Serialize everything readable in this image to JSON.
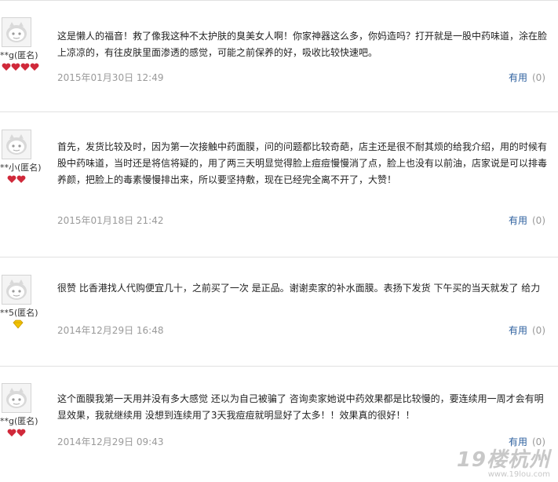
{
  "reviews": [
    {
      "user": "**g(匿名)",
      "rank_icon": "heart-icon",
      "rank_count": 4,
      "text": "这是懒人的福音！救了像我这种不太护肤的臭美女人啊！你家神器这么多，你妈造吗？打开就是一股中药味道，涂在脸上凉凉的，有往皮肤里面渗透的感觉，可能之前保养的好，吸收比较快速吧。",
      "date": "2015年01月30日 12:49",
      "useful_label": "有用",
      "useful_count": "(0)"
    },
    {
      "user": "**小(匿名)",
      "rank_icon": "heart-icon",
      "rank_count": 2,
      "text": "首先，发货比较及时，因为第一次接触中药面膜，问的问题都比较奇葩，店主还是很不耐其烦的给我介绍，用的时候有股中药味道，当时还是将信将疑的，用了两三天明显觉得脸上痘痘慢慢消了点，脸上也没有以前油，店家说是可以排毒养颜，把脸上的毒素慢慢排出来，所以要坚持敷，现在已经完全离不开了，大赞！",
      "date": "2015年01月18日 21:42",
      "useful_label": "有用",
      "useful_count": "(0)"
    },
    {
      "user": "**5(匿名)",
      "rank_icon": "diamond-icon",
      "rank_count": 1,
      "text": "很赞 比香港找人代购便宜几十，之前买了一次 是正品。谢谢卖家的补水面膜。表扬下发货 下午买的当天就发了 给力",
      "date": "2014年12月29日 16:48",
      "useful_label": "有用",
      "useful_count": "(0)"
    },
    {
      "user": "**g(匿名)",
      "rank_icon": "heart-icon",
      "rank_count": 2,
      "text": "这个面膜我第一天用并没有多大感觉 还以为自己被骗了 咨询卖家她说中药效果都是比较慢的，要连续用一周才会有明显效果，我就继续用 没想到连续用了3天我痘痘就明显好了太多！！效果真的很好！！",
      "date": "2014年12月29日 09:43",
      "useful_label": "有用",
      "useful_count": "(0)"
    }
  ],
  "watermark": {
    "logo": "19楼杭州",
    "url": "www.19lou.com"
  },
  "colors": {
    "heart": "#d0293a",
    "diamond": "#f2c200",
    "useful_link": "#2c5f9e",
    "date": "#9a9a9a"
  }
}
